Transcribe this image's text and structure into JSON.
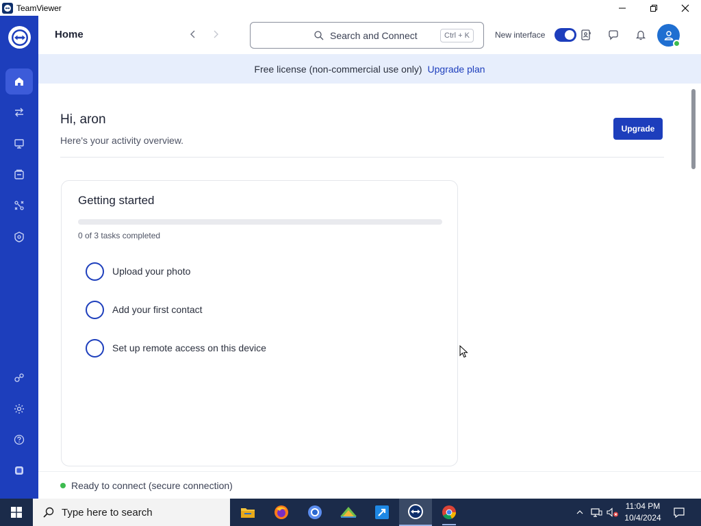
{
  "window": {
    "title": "TeamViewer",
    "minimize_icon": "minimize-icon",
    "restore_icon": "restore-icon",
    "close_icon": "close-icon"
  },
  "sidebar": {
    "logo_icon": "teamviewer-logo-icon",
    "items": [
      {
        "icon": "home-icon",
        "active": true
      },
      {
        "icon": "remote-connect-arrows-icon",
        "active": false
      },
      {
        "icon": "devices-icon",
        "active": false
      },
      {
        "icon": "contacts-list-icon",
        "active": false
      },
      {
        "icon": "workflow-icon",
        "active": false
      },
      {
        "icon": "security-shield-icon",
        "active": false
      }
    ],
    "bottom_items": [
      {
        "icon": "community-icon"
      },
      {
        "icon": "settings-gear-icon"
      },
      {
        "icon": "help-icon"
      },
      {
        "icon": "collapse-panel-icon"
      }
    ]
  },
  "header": {
    "title": "Home",
    "search": {
      "placeholder": "Search and Connect",
      "shortcut": "Ctrl + K"
    },
    "new_interface_label": "New interface",
    "new_interface_enabled": true,
    "icons": [
      "address-book-icon",
      "chat-icon",
      "notification-bell-icon"
    ],
    "avatar_online": true
  },
  "banner": {
    "text": "Free license (non-commercial use only)",
    "link": "Upgrade plan"
  },
  "overview": {
    "greeting": "Hi, aron",
    "subtitle": "Here's your activity overview.",
    "upgrade_button": "Upgrade"
  },
  "getting_started": {
    "title": "Getting started",
    "progress_fraction": 0,
    "progress_text": "0 of 3 tasks completed",
    "tasks": [
      {
        "label": "Upload your photo",
        "done": false
      },
      {
        "label": "Add your first contact",
        "done": false
      },
      {
        "label": "Set up remote access on this device",
        "done": false
      }
    ]
  },
  "status": {
    "text": "Ready to connect (secure connection)",
    "color": "#3dbb4f"
  },
  "taskbar": {
    "search_placeholder": "Type here to search",
    "apps": [
      "file-explorer-icon",
      "firefox-icon",
      "edge-chromium-icon",
      "sketch-app-icon",
      "remote-arrow-app-icon",
      "teamviewer-icon",
      "chrome-icon"
    ],
    "active_app": "teamviewer-icon",
    "time": "11:04 PM",
    "date": "10/4/2024"
  },
  "colors": {
    "sidebar": "#1d3ebc",
    "accent": "#1d3ebc",
    "banner": "#e7eefc",
    "taskbar": "#1b2b4a"
  }
}
